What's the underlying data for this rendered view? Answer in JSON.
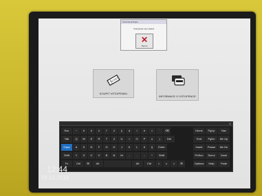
{
  "dialog": {
    "title": "Kontrola přístupu",
    "message": "Vstupenka není platná",
    "button_label": "Storno"
  },
  "tiles": [
    {
      "label": "KOUPIT VSTUPENKU",
      "icon": "ticket-icon"
    },
    {
      "label": "INFORMACE O VSTUPENCE",
      "icon": "card-reader-icon"
    }
  ],
  "keyboard": {
    "rows": [
      [
        "Esc",
        "~",
        "ě",
        "š",
        "č",
        "ř",
        "ž",
        "ý",
        "á",
        "í",
        "é",
        "=",
        "´",
        "⌫"
      ],
      [
        "Tab",
        "Q",
        "W",
        "E",
        "R",
        "T",
        "Z",
        "U",
        "I",
        "O",
        "P",
        "ú",
        ")",
        "Del"
      ],
      [
        "Caps",
        "A",
        "S",
        "D",
        "F",
        "G",
        "H",
        "J",
        "K",
        "L",
        "ů",
        "§",
        "Enter"
      ],
      [
        "Shift",
        "Y",
        "X",
        "C",
        "V",
        "B",
        "N",
        "M",
        ",",
        ".",
        "-",
        "^",
        "Shift"
      ],
      [
        "Fn",
        "Ctrl",
        "⊞",
        "Alt",
        "",
        "Alt",
        "Ctrl",
        "<",
        "v",
        ">",
        "⊞"
      ]
    ],
    "nav": [
      [
        "Home",
        "PgUp",
        "Nav"
      ],
      [
        "End",
        "PgDn",
        "Mv Up"
      ],
      [
        "Insert",
        "Pause",
        "Mv Dn"
      ],
      [
        "PrtScn",
        "ScrLk",
        "Dock"
      ],
      [
        "Options",
        "Help",
        "Fade"
      ]
    ],
    "active_key": "Caps",
    "accent_color": "#1f6fc4"
  },
  "status": {
    "time": "12:44",
    "date": "06.03.2019"
  }
}
